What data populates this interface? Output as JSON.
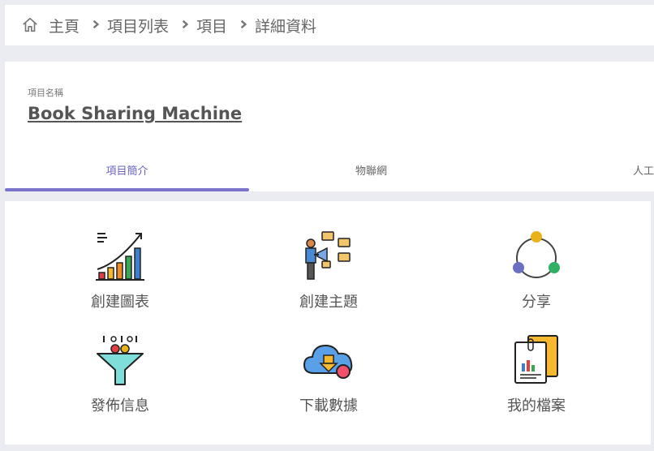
{
  "breadcrumb": {
    "items": [
      "主頁",
      "項目列表",
      "項目",
      "詳細資料"
    ]
  },
  "project": {
    "label": "項目名稱",
    "title": "Book Sharing Machine"
  },
  "tabs": [
    {
      "label": "項目簡介",
      "active": true
    },
    {
      "label": "物聯網",
      "active": false
    },
    {
      "label": "人工",
      "active": false
    }
  ],
  "actions": [
    {
      "label": "創建圖表",
      "icon": "bar-chart-growth-icon"
    },
    {
      "label": "創建主題",
      "icon": "broadcast-topic-icon"
    },
    {
      "label": "分享",
      "icon": "share-nodes-icon"
    },
    {
      "label": "發佈信息",
      "icon": "funnel-publish-icon"
    },
    {
      "label": "下載數據",
      "icon": "cloud-download-icon"
    },
    {
      "label": "我的檔案",
      "icon": "files-icon"
    }
  ],
  "colors": {
    "accent": "#7a73cc",
    "background": "#ebebf2"
  }
}
